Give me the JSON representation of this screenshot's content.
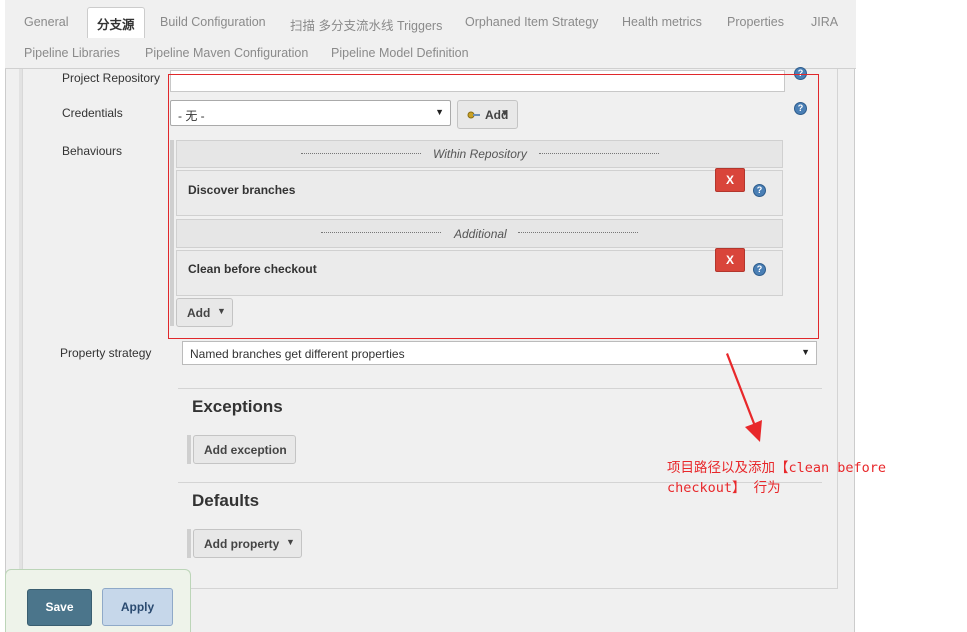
{
  "tabs": {
    "row1": [
      "General",
      "分支源",
      "Build Configuration",
      "扫描 多分支流水线 Triggers",
      "Orphaned Item Strategy",
      "Health metrics",
      "Properties",
      "JIRA"
    ],
    "row2": [
      "Pipeline Libraries",
      "Pipeline Maven Configuration",
      "Pipeline Model Definition"
    ],
    "active": "分支源"
  },
  "form": {
    "project_repository_label": "Project Repository",
    "project_repository_value": "",
    "credentials_label": "Credentials",
    "credentials_value": "- 无 -",
    "add_credentials_label": "Add",
    "behaviours_label": "Behaviours",
    "within_repository_title": "Within Repository",
    "discover_branches": "Discover branches",
    "additional_title": "Additional",
    "clean_before_checkout": "Clean before checkout",
    "remove_label": "X",
    "add_behaviour_label": "Add",
    "property_strategy_label": "Property strategy",
    "property_strategy_value": "Named branches get different properties"
  },
  "exceptions": {
    "title": "Exceptions",
    "add_label": "Add exception"
  },
  "defaults": {
    "title": "Defaults",
    "add_label": "Add property"
  },
  "actions": {
    "save": "Save",
    "apply": "Apply"
  },
  "annotation": {
    "text": "项目路径以及添加【clean before checkout】 行为",
    "color": "#e8282b"
  },
  "icons": {
    "help": "help-icon",
    "key": "key-icon",
    "caret": "caret-down-icon"
  }
}
